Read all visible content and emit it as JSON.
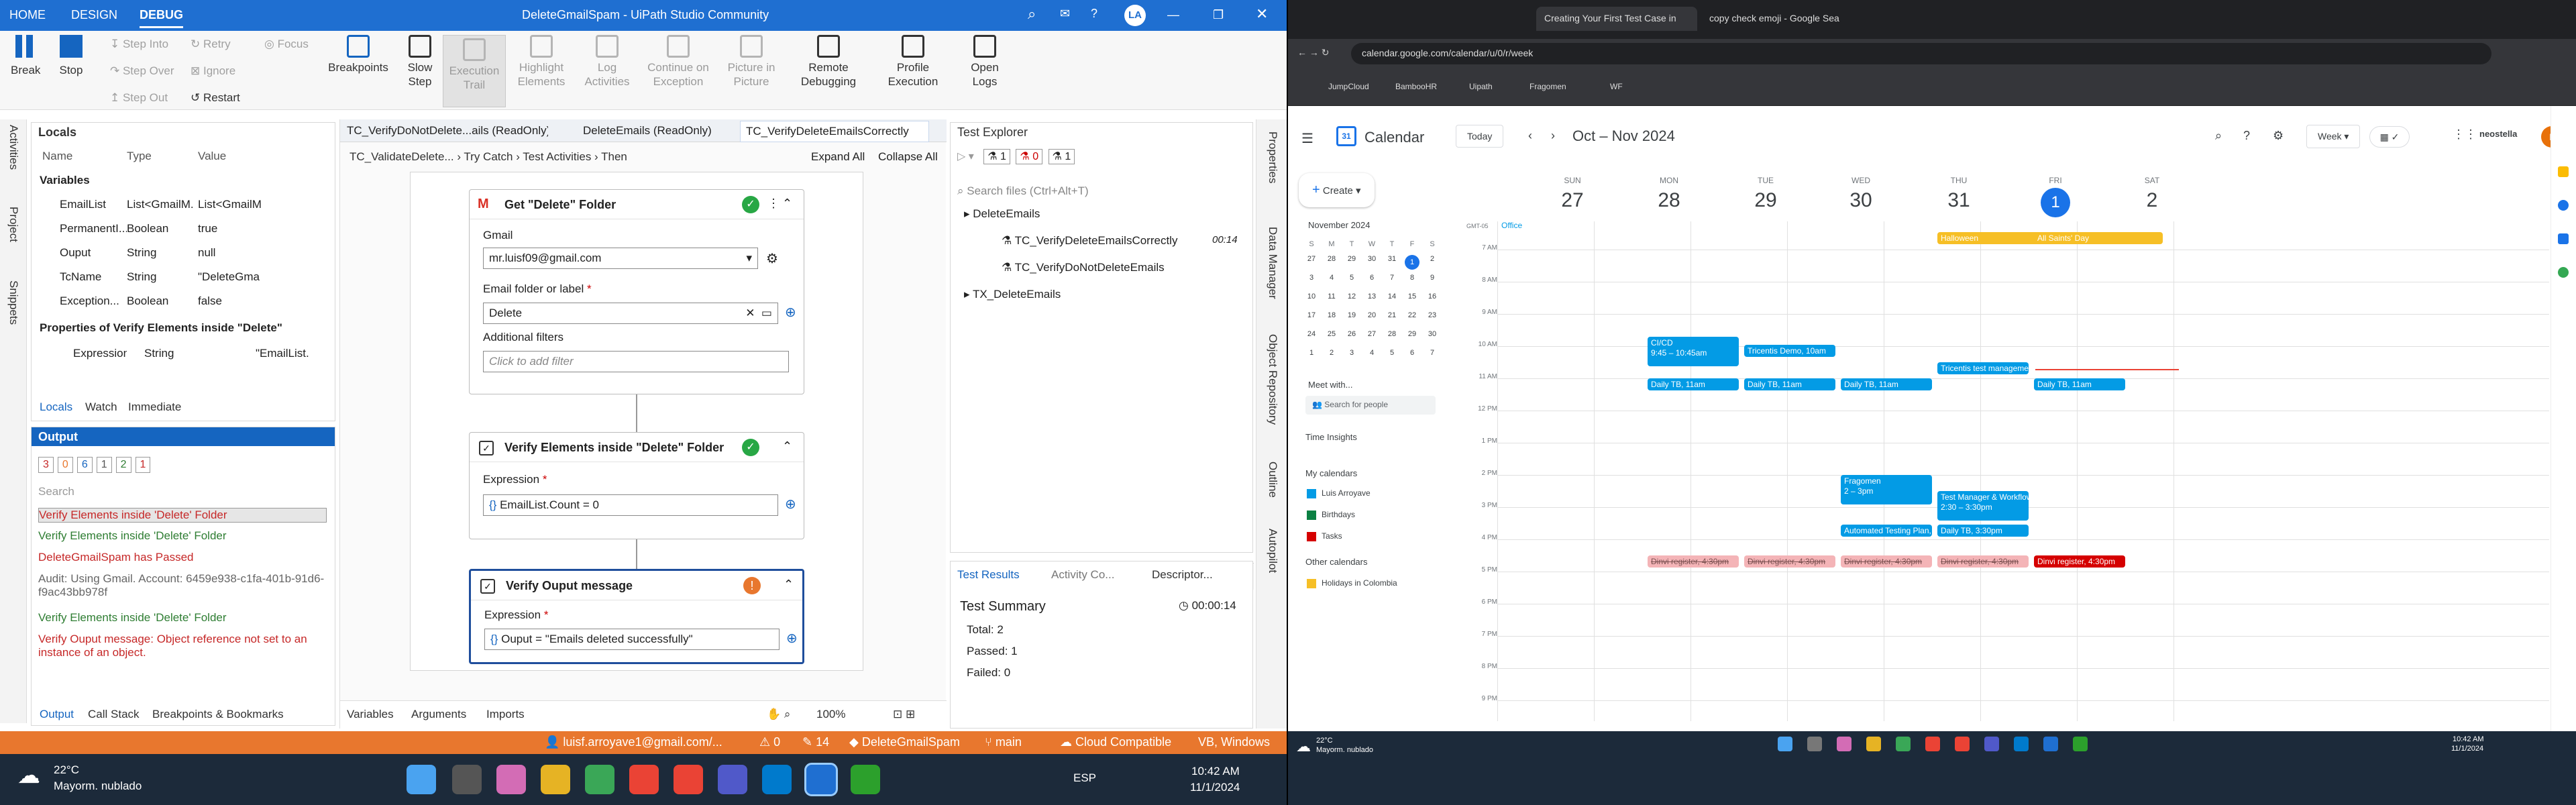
{
  "uipath": {
    "menu": {
      "home": "HOME",
      "design": "DESIGN",
      "debug": "DEBUG"
    },
    "title": "DeleteGmailSpam - UiPath Studio Community",
    "user_initials": "LA",
    "ribbon": {
      "break": "Break",
      "stop": "Stop",
      "step_into": "Step Into",
      "step_over": "Step Over",
      "step_out": "Step Out",
      "retry": "Retry",
      "ignore": "Ignore",
      "restart": "Restart",
      "focus": "Focus",
      "breakpoints": "Breakpoints",
      "slow_step": "Slow Step",
      "execution_trail": "Execution Trail",
      "highlight": "Highlight Elements",
      "log": "Log Activities",
      "continue": "Continue on Exception",
      "picture": "Picture in Picture",
      "remote": "Remote Debugging",
      "profile": "Profile Execution",
      "open_logs": "Open Logs"
    },
    "side_tabs": [
      "Activities",
      "Project",
      "Snippets"
    ],
    "right_tabs": [
      "Properties",
      "Data Manager",
      "Object Repository",
      "Outline",
      "Autopilot"
    ],
    "locals": {
      "title": "Locals",
      "cols": [
        "Name",
        "Type",
        "Value"
      ],
      "group1": "Variables",
      "rows": [
        {
          "name": "EmailList",
          "type": "List<GmailM...",
          "value": "List<GmailM"
        },
        {
          "name": "PermanentI...",
          "type": "Boolean",
          "value": "true"
        },
        {
          "name": "Ouput",
          "type": "String",
          "value": "null"
        },
        {
          "name": "TcName",
          "type": "String",
          "value": "\"DeleteGma"
        },
        {
          "name": "Exception...",
          "type": "Boolean",
          "value": "false"
        }
      ],
      "group2": "Properties of Verify Elements inside \"Delete\"",
      "rows2": [
        {
          "name": "Expression",
          "type": "String",
          "value": "\"EmailList."
        }
      ],
      "tabs": [
        "Locals",
        "Watch",
        "Immediate"
      ]
    },
    "output": {
      "title": "Output",
      "counts": [
        "3",
        "0",
        "6",
        "1",
        "2",
        "1"
      ],
      "search": "Search",
      "lines": [
        {
          "t": "Verify Elements inside 'Delete' Folder",
          "c": "#c62828"
        },
        {
          "t": "Verify Elements inside 'Delete' Folder",
          "c": "#2e7d32"
        },
        {
          "t": "DeleteGmailSpam has Passed",
          "c": "#c62828"
        },
        {
          "t": "Audit: Using Gmail. Account: 6459e938-c1fa-401b-91d6-f9ac43bb978f",
          "c": "#666"
        },
        {
          "t": "Verify Elements inside 'Delete' Folder",
          "c": "#2e7d32"
        },
        {
          "t": "Verify Ouput message: Object reference not set to an instance of an object.",
          "c": "#c62828"
        }
      ],
      "tabs": [
        "Output",
        "Call Stack",
        "Breakpoints & Bookmarks"
      ]
    },
    "doc_tabs": [
      "TC_VerifyDoNotDelete...ails (ReadOnly)",
      "DeleteEmails (ReadOnly)",
      "TC_VerifyDeleteEmailsCorrectly"
    ],
    "breadcrumb": [
      "TC_ValidateDelete...",
      "Try Catch",
      "Test Activities",
      "Then"
    ],
    "expand_all": "Expand All",
    "collapse_all": "Collapse All",
    "act1": {
      "title": "Get \"Delete\" Folder",
      "gmail_label": "Gmail",
      "gmail": "mr.luisf09@gmail.com",
      "folder_label": "Email folder or label",
      "folder": "Delete",
      "filters_label": "Additional filters",
      "filters_ph": "Click to add filter"
    },
    "act2": {
      "title": "Verify Elements inside \"Delete\" Folder",
      "expr_label": "Expression",
      "expr": "EmailList.Count = 0"
    },
    "act3": {
      "title": "Verify Ouput message",
      "expr_label": "Expression",
      "expr": "Ouput = \"Emails deleted successfully\""
    },
    "bottom_tabs": [
      "Variables",
      "Arguments",
      "Imports"
    ],
    "zoom": "100%",
    "test_explorer": {
      "title": "Test Explorer",
      "badges": [
        "1",
        "0",
        "1"
      ],
      "search": "Search files (Ctrl+Alt+T)",
      "tree": [
        {
          "label": "DeleteEmails",
          "depth": 0
        },
        {
          "label": "TC_VerifyDeleteEmailsCorrectly",
          "depth": 1,
          "time": "00:14"
        },
        {
          "label": "TC_VerifyDoNotDeleteEmails",
          "depth": 1
        },
        {
          "label": "TX_DeleteEmails",
          "depth": 0
        }
      ],
      "tabs": [
        "Test Results",
        "Activity Co...",
        "Descriptor..."
      ],
      "summary_title": "Test Summary",
      "duration": "00:00:14",
      "total": "Total: 2",
      "passed": "Passed: 1",
      "failed": "Failed: 0"
    },
    "status": {
      "user": "luisf.arroyave1@gmail.com/...",
      "warn": "0",
      "edits": "14",
      "project": "DeleteGmailSpam",
      "branch": "main",
      "cloud": "Cloud Compatible",
      "lang": "VB, Windows"
    },
    "taskbar": {
      "temp": "22°C",
      "weather": "Mayorm. nublado",
      "lang": "ESP",
      "time": "10:42 AM",
      "date": "11/1/2024"
    }
  },
  "calendar": {
    "tabs": [
      "Creating Your First Test Case in",
      "copy check emoji - Google Sea"
    ],
    "url": "calendar.google.com/calendar/u/0/r/week",
    "bookmarks": [
      "JumpCloud",
      "BambooHR",
      "Uipath",
      "Fragomen",
      "WF"
    ],
    "app": "Calendar",
    "today": "Today",
    "range": "Oct – Nov 2024",
    "view": "Week",
    "brand": "neostella",
    "create": "Create",
    "days": [
      {
        "n": "SUN",
        "d": "27"
      },
      {
        "n": "MON",
        "d": "28"
      },
      {
        "n": "TUE",
        "d": "29"
      },
      {
        "n": "WED",
        "d": "30"
      },
      {
        "n": "THU",
        "d": "31"
      },
      {
        "n": "FRI",
        "d": "1"
      },
      {
        "n": "SAT",
        "d": "2"
      }
    ],
    "tz": "GMT-05",
    "office": "Office",
    "hours": [
      "7 AM",
      "8 AM",
      "9 AM",
      "10 AM",
      "11 AM",
      "12 PM",
      "1 PM",
      "2 PM",
      "3 PM",
      "4 PM",
      "5 PM",
      "6 PM",
      "7 PM",
      "8 PM",
      "9 PM"
    ],
    "mini_month": "November 2024",
    "mini_days": [
      "S",
      "M",
      "T",
      "W",
      "T",
      "F",
      "S"
    ],
    "mini_dates": [
      "27",
      "28",
      "29",
      "30",
      "31",
      "1",
      "2",
      "3",
      "4",
      "5",
      "6",
      "7",
      "8",
      "9",
      "10",
      "11",
      "12",
      "13",
      "14",
      "15",
      "16",
      "17",
      "18",
      "19",
      "20",
      "21",
      "22",
      "23",
      "24",
      "25",
      "26",
      "27",
      "28",
      "29",
      "30",
      "1",
      "2",
      "3",
      "4",
      "5",
      "6",
      "7"
    ],
    "meet": "Meet with...",
    "search_people": "Search for people",
    "time_insights": "Time Insights",
    "my_cals": "My calendars",
    "cals": [
      "Luis Arroyave",
      "Birthdays",
      "Tasks"
    ],
    "other_cals": "Other calendars",
    "other": [
      "Holidays in Colombia"
    ],
    "events": {
      "halloween": "Halloween",
      "allsaints": "All Saints' Day",
      "cicd": "CI/CD",
      "cicd_time": "9:45 – 10:45am",
      "tricentis_demo": "Tricentis Demo, 10am",
      "tricentis_tm": "Tricentis test management for Jira d",
      "daily": "Daily TB, 11am",
      "fragomen": "Fragomen",
      "fragomen_time": "2 – 3pm",
      "testmgr": "Test Manager & Workflow in Fragom",
      "testmgr_time": "2:30 – 3:30pm",
      "autoplan": "Automated Testing Plan, 3:30pm",
      "dailytb330": "Daily TB, 3:30pm",
      "dinvi": "Dinvi register, 4:30pm"
    },
    "taskbar": {
      "temp": "22°C",
      "weather": "Mayorm. nublado",
      "time": "10:42 AM",
      "date": "11/1/2024"
    }
  }
}
